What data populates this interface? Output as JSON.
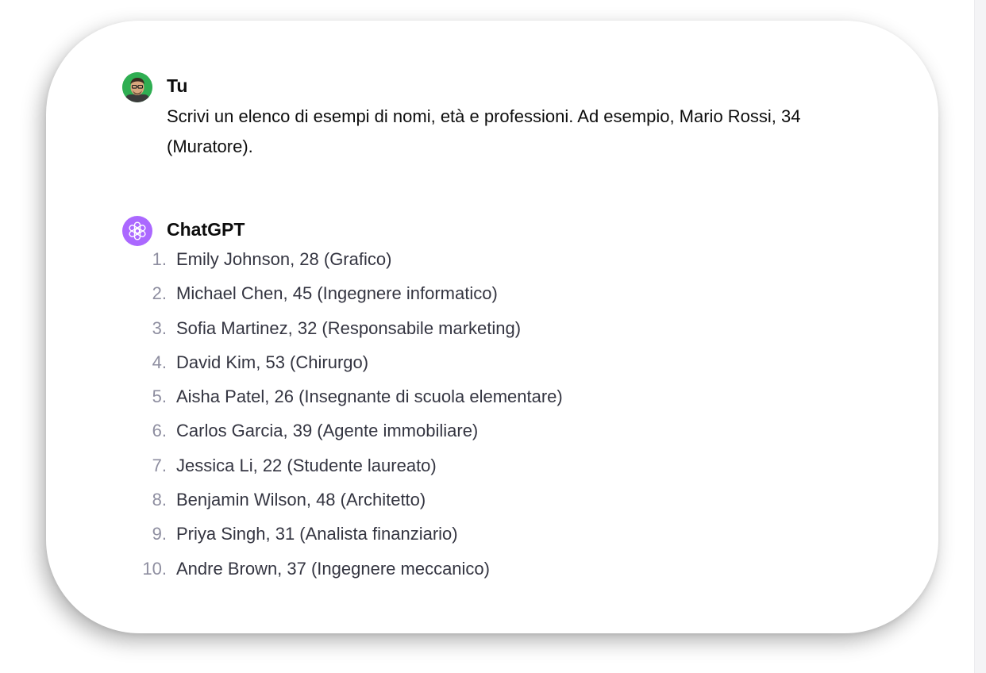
{
  "conversation": {
    "user_message": {
      "author": "Tu",
      "text": "Scrivi un elenco di esempi di nomi, età e professioni. Ad esempio, Mario Rossi, 34 (Muratore)."
    },
    "assistant_message": {
      "author": "ChatGPT",
      "items": [
        {
          "number": "1.",
          "text": "Emily Johnson, 28 (Grafico)"
        },
        {
          "number": "2.",
          "text": "Michael Chen, 45 (Ingegnere informatico)"
        },
        {
          "number": "3.",
          "text": "Sofia Martinez, 32 (Responsabile marketing)"
        },
        {
          "number": "4.",
          "text": "David Kim, 53 (Chirurgo)"
        },
        {
          "number": "5.",
          "text": "Aisha Patel, 26 (Insegnante di scuola elementare)"
        },
        {
          "number": "6.",
          "text": "Carlos Garcia, 39 (Agente immobiliare)"
        },
        {
          "number": "7.",
          "text": "Jessica Li, 22 (Studente laureato)"
        },
        {
          "number": "8.",
          "text": "Benjamin Wilson, 48 (Architetto)"
        },
        {
          "number": "9.",
          "text": "Priya Singh, 31 (Analista finanziario)"
        },
        {
          "number": "10.",
          "text": "Andre Brown, 37 (Ingegnere meccanico)"
        }
      ]
    }
  },
  "icons": {
    "user_avatar": "user-avatar-photo",
    "assistant_avatar": "openai-logo-icon"
  },
  "colors": {
    "user_avatar_bg": "#2fae52",
    "assistant_avatar_bg": "#ab68ff",
    "text_primary": "#0d0d0d",
    "list_text": "#343541",
    "list_number": "#8e8ea0"
  }
}
